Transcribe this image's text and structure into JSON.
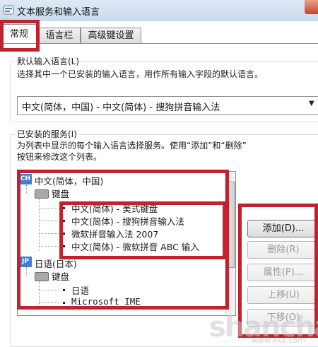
{
  "window": {
    "title": "文本服务和输入语言"
  },
  "tabs": [
    {
      "label": "常规",
      "active": true
    },
    {
      "label": "语言栏",
      "active": false
    },
    {
      "label": "高级键设置",
      "active": false
    }
  ],
  "default_language": {
    "group_label": "默认输入语言(L)",
    "description": "选择其中一个已安装的输入语言，用作所有输入字段的默认语言。",
    "selected": "中文(简体，中国) - 中文(简体) - 搜狗拼音输入法"
  },
  "installed_services": {
    "group_label": "已安装的服务(I)",
    "description_line1": "为列表中显示的每个输入语言选择服务。使用“添加”和“删除”",
    "description_line2": "按钮来修改这个列表。",
    "tree": [
      {
        "badge": "CH",
        "language": "中文(简体，中国)",
        "category": "键盘",
        "items": [
          "中文(简体) - 美式键盘",
          "中文(简体) - 搜狗拼音输入法",
          "微软拼音输入法 2007",
          "中文(简体) - 微软拼音 ABC 输入"
        ]
      },
      {
        "badge": "JP",
        "language": "日语(日本)",
        "category": "键盘",
        "items": [
          "日语",
          "Microsoft IME"
        ]
      }
    ]
  },
  "buttons": {
    "add": "添加(D)...",
    "remove": "删除(R)",
    "properties": "属性(P)...",
    "move_up": "上移(U)",
    "move_down": "下移(O)"
  },
  "watermark": {
    "main": "shancha",
    "sub": "www.xxx.com"
  },
  "colors": {
    "highlight": "#c0232f",
    "badge": "#3f7ed9"
  }
}
